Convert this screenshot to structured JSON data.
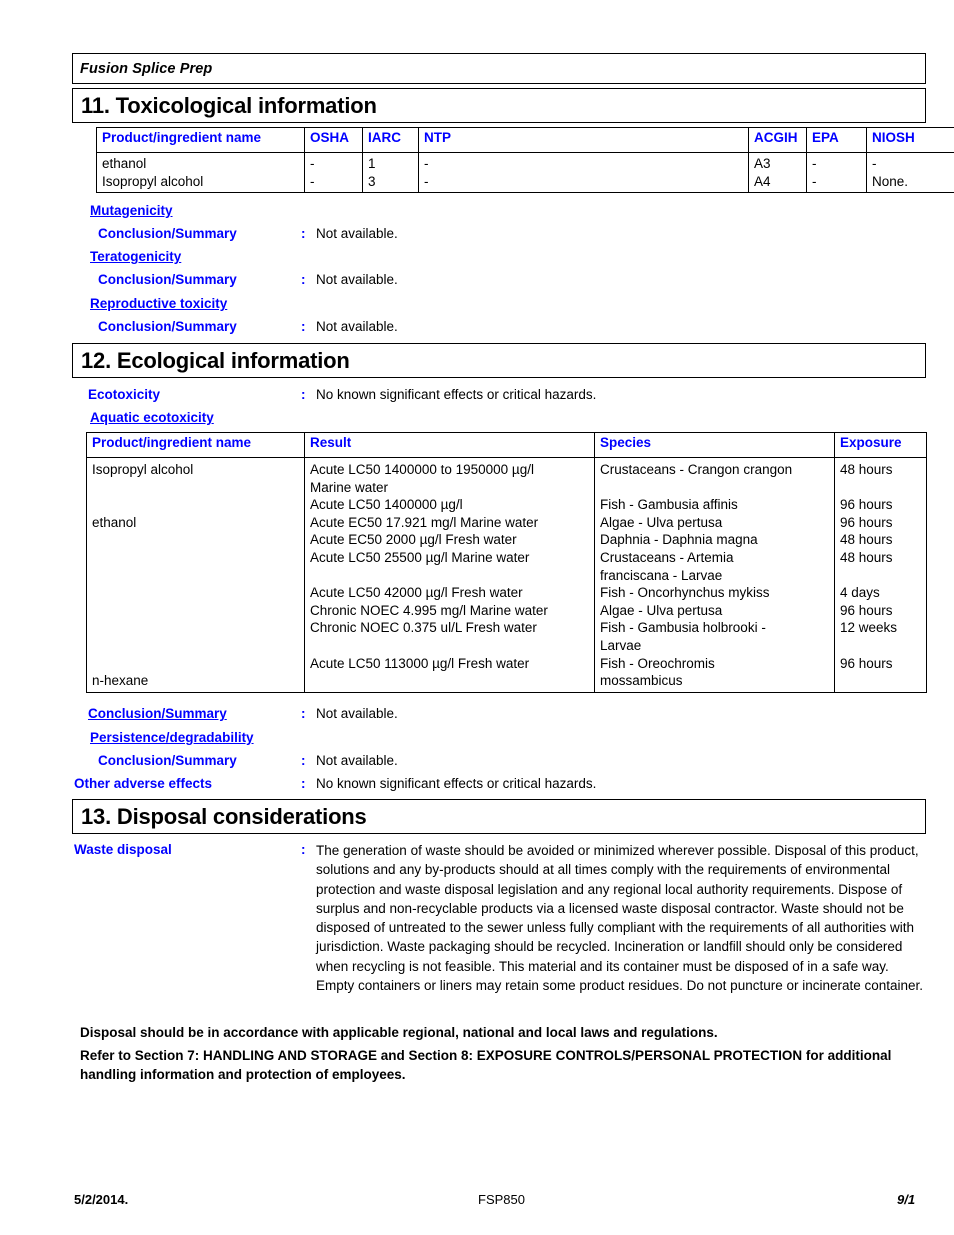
{
  "document": {
    "running_title": "Fusion Splice Prep"
  },
  "sections": {
    "toxicological": {
      "heading": "11. Toxicological information",
      "table": {
        "columns": [
          "Product/ingredient name",
          "OSHA",
          "IARC",
          "NTP",
          "ACGIH",
          "EPA",
          "NIOSH"
        ],
        "rows": [
          {
            "name": "ethanol",
            "osha": "-",
            "iarc": "1",
            "ntp": "-",
            "acgih": "A3",
            "epa": "-",
            "niosh": "-"
          },
          {
            "name": "Isopropyl alcohol",
            "osha": "-",
            "iarc": "3",
            "ntp": "-",
            "acgih": "A4",
            "epa": "-",
            "niosh": "None."
          }
        ]
      },
      "mutagenicity": {
        "heading": "Mutagenicity",
        "conclusion_label": "Conclusion/Summary",
        "colon": ":",
        "conclusion_value": "Not available."
      },
      "teratogenicity": {
        "heading": "Teratogenicity",
        "conclusion_label": "Conclusion/Summary",
        "colon": ":",
        "conclusion_value": "Not available."
      },
      "reproductive_toxicity": {
        "heading": "Reproductive toxicity",
        "conclusion_label": "Conclusion/Summary",
        "colon": ":",
        "conclusion_value": "Not available."
      }
    },
    "ecological": {
      "heading": "12. Ecological information",
      "ecotoxicity": {
        "label": "Ecotoxicity",
        "colon": ":",
        "value": "No known significant effects or critical hazards."
      },
      "aquatic_heading": "Aquatic ecotoxicity",
      "table": {
        "columns": [
          "Product/ingredient name",
          "Result",
          "Species",
          "Exposure"
        ],
        "rows": [
          {
            "name": "Isopropyl alcohol",
            "result": "Acute LC50 1400000 to 1950000 µg/l Marine water",
            "species": "Crustaceans - Crangon crangon",
            "exposure": "48 hours"
          },
          {
            "name": "",
            "result": "Acute LC50 1400000 µg/l",
            "species": "Fish - Gambusia affinis",
            "exposure": "96 hours"
          },
          {
            "name": "ethanol",
            "result": "Acute EC50 17.921 mg/l Marine water",
            "species": "Algae - Ulva pertusa",
            "exposure": "96 hours"
          },
          {
            "name": "",
            "result": "Acute EC50 2000 µg/l Fresh water",
            "species": "Daphnia - Daphnia magna",
            "exposure": "48 hours"
          },
          {
            "name": "",
            "result": "Acute LC50 25500 µg/l Marine water",
            "species": "Crustaceans - Artemia franciscana - Larvae",
            "exposure": "48 hours"
          },
          {
            "name": "",
            "result": "Acute LC50 42000 µg/l Fresh water",
            "species": "Fish - Oncorhynchus mykiss",
            "exposure": "4 days"
          },
          {
            "name": "",
            "result": "Chronic NOEC 4.995 mg/l Marine water",
            "species": "Algae - Ulva pertusa",
            "exposure": "96 hours"
          },
          {
            "name": "",
            "result": "Chronic NOEC 0.375 ul/L Fresh water",
            "species": "Fish - Gambusia holbrooki - Larvae",
            "exposure": "12 weeks"
          },
          {
            "name": "n-hexane",
            "result": "Acute LC50 113000 µg/l Fresh water",
            "species": "Fish - Oreochromis mossambicus",
            "exposure": "96 hours"
          }
        ]
      },
      "aquatic_conclusion": {
        "label": "Conclusion/Summary",
        "colon": ":",
        "value": "Not available."
      },
      "persistence": {
        "heading": "Persistence/degradability",
        "conclusion_label": "Conclusion/Summary",
        "colon": ":",
        "conclusion_value": "Not available."
      },
      "other_adverse_effects": {
        "label": "Other adverse effects",
        "colon": ":",
        "value": "No known significant effects or critical hazards."
      }
    },
    "disposal": {
      "heading": "13. Disposal considerations",
      "waste_disposal": {
        "label": "Waste disposal",
        "colon": ":",
        "value": "The generation of waste should be avoided or minimized wherever possible.  Disposal of this product, solutions and any by-products should at all times comply with the requirements of environmental protection and waste disposal legislation and any regional local authority requirements.  Dispose of surplus and non-recyclable products via a licensed waste disposal contractor.  Waste should not be disposed of untreated to the sewer unless fully compliant with the requirements of all authorities with jurisdiction.  Waste packaging should be recycled.  Incineration or landfill should only be considered when recycling is not feasible.  This material and its container must be disposed of in a safe way.  Empty containers or liners may retain some product residues.  Do not puncture or incinerate container."
      },
      "note_1": "Disposal should be in accordance with applicable regional, national and local laws and regulations.",
      "note_2": "Refer to Section 7: HANDLING AND STORAGE and Section 8: EXPOSURE CONTROLS/PERSONAL PROTECTION for additional handling information and protection of employees."
    }
  },
  "footer": {
    "date": "5/2/2014.",
    "product_code": "FSP850",
    "page": "9/1"
  },
  "colors": {
    "accent_blue": "#0000ff",
    "text_black": "#000000",
    "background": "#ffffff"
  }
}
